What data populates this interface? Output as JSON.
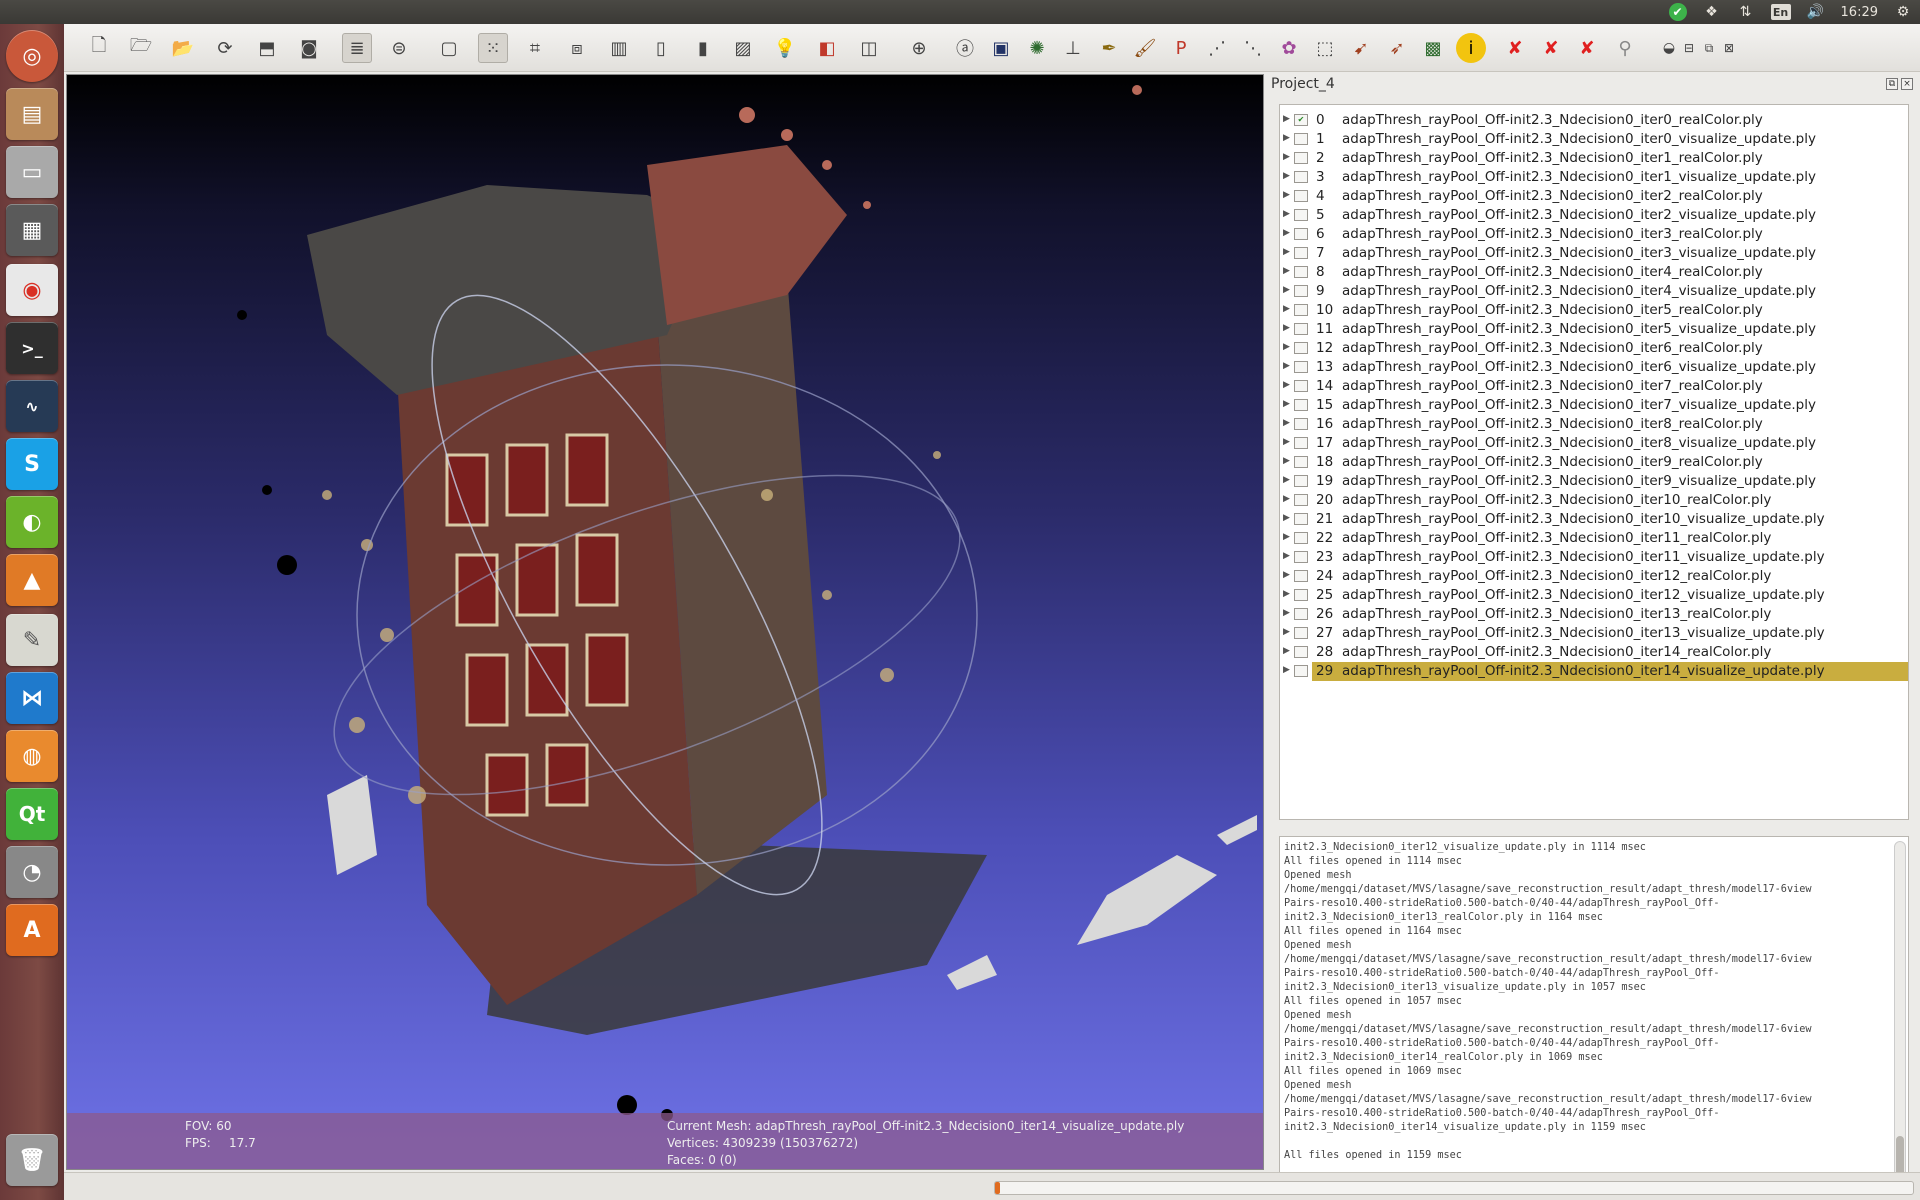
{
  "system": {
    "clock": "16:29",
    "language": "En",
    "tray_icons": [
      "status-ok-icon",
      "dropbox-icon",
      "network-icon",
      "keyboard-lang-icon",
      "volume-icon",
      "settings-icon"
    ]
  },
  "launcher": {
    "items": [
      "ubuntu-dash",
      "files",
      "drive",
      "workspace-switcher",
      "chrome",
      "terminal",
      "system-monitor",
      "skype",
      "nvidia-settings",
      "matlab",
      "text-editor",
      "vscode",
      "firefox",
      "qt-creator",
      "eye-of-gnome",
      "ubuntu-software",
      "trash"
    ]
  },
  "toolbar": {
    "tools": [
      "new-project",
      "open-project",
      "import-mesh",
      "reload",
      "export-mesh",
      "snapshot",
      "layers",
      "render-mode",
      "bbox",
      "points",
      "wireframe",
      "hiddenlines",
      "flat-lines",
      "flat",
      "smooth",
      "texture",
      "light",
      "color",
      "paint",
      "global-view",
      "measure",
      "info-snapshot",
      "normals",
      "align",
      "quality-mapper",
      "manipulator",
      "brush",
      "paint-pdf",
      "select-vertices",
      "select-faces",
      "select-connected",
      "select-plane",
      "edit-texture",
      "fill-hole",
      "geo-ref",
      "info",
      "delete-vertices",
      "delete-faces",
      "delete-selected",
      "search"
    ],
    "active_tool": "layers"
  },
  "viewport": {
    "fov_label": "FOV: 60",
    "fps_label": "FPS:",
    "fps_value": "17.7",
    "current_mesh": "Current Mesh: adapThresh_rayPool_Off-init2.3_Ndecision0_iter14_visualize_update.ply",
    "vertices": "Vertices: 4309239 (150376272)",
    "faces": "Faces: 0 (0)"
  },
  "project": {
    "title": "Project_4",
    "layers": [
      {
        "idx": "0",
        "name": "adapThresh_rayPool_Off-init2.3_Ndecision0_iter0_realColor.ply"
      },
      {
        "idx": "1",
        "name": "adapThresh_rayPool_Off-init2.3_Ndecision0_iter0_visualize_update.ply"
      },
      {
        "idx": "2",
        "name": "adapThresh_rayPool_Off-init2.3_Ndecision0_iter1_realColor.ply"
      },
      {
        "idx": "3",
        "name": "adapThresh_rayPool_Off-init2.3_Ndecision0_iter1_visualize_update.ply"
      },
      {
        "idx": "4",
        "name": "adapThresh_rayPool_Off-init2.3_Ndecision0_iter2_realColor.ply"
      },
      {
        "idx": "5",
        "name": "adapThresh_rayPool_Off-init2.3_Ndecision0_iter2_visualize_update.ply"
      },
      {
        "idx": "6",
        "name": "adapThresh_rayPool_Off-init2.3_Ndecision0_iter3_realColor.ply"
      },
      {
        "idx": "7",
        "name": "adapThresh_rayPool_Off-init2.3_Ndecision0_iter3_visualize_update.ply"
      },
      {
        "idx": "8",
        "name": "adapThresh_rayPool_Off-init2.3_Ndecision0_iter4_realColor.ply"
      },
      {
        "idx": "9",
        "name": "adapThresh_rayPool_Off-init2.3_Ndecision0_iter4_visualize_update.ply"
      },
      {
        "idx": "10",
        "name": "adapThresh_rayPool_Off-init2.3_Ndecision0_iter5_realColor.ply"
      },
      {
        "idx": "11",
        "name": "adapThresh_rayPool_Off-init2.3_Ndecision0_iter5_visualize_update.ply"
      },
      {
        "idx": "12",
        "name": "adapThresh_rayPool_Off-init2.3_Ndecision0_iter6_realColor.ply"
      },
      {
        "idx": "13",
        "name": "adapThresh_rayPool_Off-init2.3_Ndecision0_iter6_visualize_update.ply"
      },
      {
        "idx": "14",
        "name": "adapThresh_rayPool_Off-init2.3_Ndecision0_iter7_realColor.ply"
      },
      {
        "idx": "15",
        "name": "adapThresh_rayPool_Off-init2.3_Ndecision0_iter7_visualize_update.ply"
      },
      {
        "idx": "16",
        "name": "adapThresh_rayPool_Off-init2.3_Ndecision0_iter8_realColor.ply"
      },
      {
        "idx": "17",
        "name": "adapThresh_rayPool_Off-init2.3_Ndecision0_iter8_visualize_update.ply"
      },
      {
        "idx": "18",
        "name": "adapThresh_rayPool_Off-init2.3_Ndecision0_iter9_realColor.ply"
      },
      {
        "idx": "19",
        "name": "adapThresh_rayPool_Off-init2.3_Ndecision0_iter9_visualize_update.ply"
      },
      {
        "idx": "20",
        "name": "adapThresh_rayPool_Off-init2.3_Ndecision0_iter10_realColor.ply"
      },
      {
        "idx": "21",
        "name": "adapThresh_rayPool_Off-init2.3_Ndecision0_iter10_visualize_update.ply"
      },
      {
        "idx": "22",
        "name": "adapThresh_rayPool_Off-init2.3_Ndecision0_iter11_realColor.ply"
      },
      {
        "idx": "23",
        "name": "adapThresh_rayPool_Off-init2.3_Ndecision0_iter11_visualize_update.ply"
      },
      {
        "idx": "24",
        "name": "adapThresh_rayPool_Off-init2.3_Ndecision0_iter12_realColor.ply"
      },
      {
        "idx": "25",
        "name": "adapThresh_rayPool_Off-init2.3_Ndecision0_iter12_visualize_update.ply"
      },
      {
        "idx": "26",
        "name": "adapThresh_rayPool_Off-init2.3_Ndecision0_iter13_realColor.ply"
      },
      {
        "idx": "27",
        "name": "adapThresh_rayPool_Off-init2.3_Ndecision0_iter13_visualize_update.ply"
      },
      {
        "idx": "28",
        "name": "adapThresh_rayPool_Off-init2.3_Ndecision0_iter14_realColor.ply"
      },
      {
        "idx": "29",
        "name": "adapThresh_rayPool_Off-init2.3_Ndecision0_iter14_visualize_update.ply"
      }
    ],
    "selected_layer": "29"
  },
  "log": {
    "lines": [
      "init2.3_Ndecision0_iter12_visualize_update.ply in 1114 msec",
      "All files opened in 1114 msec",
      "Opened mesh",
      "/home/mengqi/dataset/MVS/lasagne/save_reconstruction_result/adapt_thresh/model17-6view",
      "Pairs-reso10.400-strideRatio0.500-batch-0/40-44/adapThresh_rayPool_Off-",
      "init2.3_Ndecision0_iter13_realColor.ply in 1164 msec",
      "All files opened in 1164 msec",
      "Opened mesh",
      "/home/mengqi/dataset/MVS/lasagne/save_reconstruction_result/adapt_thresh/model17-6view",
      "Pairs-reso10.400-strideRatio0.500-batch-0/40-44/adapThresh_rayPool_Off-",
      "init2.3_Ndecision0_iter13_visualize_update.ply in 1057 msec",
      "All files opened in 1057 msec",
      "Opened mesh",
      "/home/mengqi/dataset/MVS/lasagne/save_reconstruction_result/adapt_thresh/model17-6view",
      "Pairs-reso10.400-strideRatio0.500-batch-0/40-44/adapThresh_rayPool_Off-",
      "init2.3_Ndecision0_iter14_realColor.ply in 1069 msec",
      "All files opened in 1069 msec",
      "Opened mesh",
      "/home/mengqi/dataset/MVS/lasagne/save_reconstruction_result/adapt_thresh/model17-6view",
      "Pairs-reso10.400-strideRatio0.500-batch-0/40-44/adapThresh_rayPool_Off-",
      "init2.3_Ndecision0_iter14_visualize_update.ply in 1159 msec",
      "",
      "All files opened in 1159 msec"
    ]
  },
  "status": {
    "progress_fraction": 0.005
  },
  "colors": {
    "selection": "#c9ad3f",
    "progress": "#e06b1f",
    "launcher": "#7d4a44"
  }
}
